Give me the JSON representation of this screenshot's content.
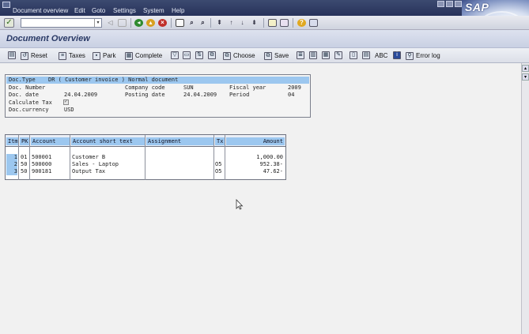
{
  "menubar": {
    "items": [
      "Document overview",
      "Edit",
      "Goto",
      "Settings",
      "System",
      "Help"
    ],
    "logo_text": "SAP"
  },
  "std_toolbar": {
    "command_value": ""
  },
  "title": "Document Overview",
  "app_toolbar": {
    "reset": "Reset",
    "taxes": "Taxes",
    "park": "Park",
    "complete": "Complete",
    "choose": "Choose",
    "save": "Save",
    "abc": "ABC",
    "error_log": "Error log"
  },
  "header": {
    "doc_type_label": "Doc.Type",
    "doc_type_value": "DR ( Customer invoice ) Normal document",
    "doc_number_label": "Doc. Number",
    "company_code_label": "Company code",
    "company_code_value": "SUN",
    "fiscal_year_label": "Fiscal year",
    "fiscal_year_value": "2009",
    "doc_date_label": "Doc. date",
    "doc_date_value": "24.04.2009",
    "posting_date_label": "Posting date",
    "posting_date_value": "24.04.2009",
    "period_label": "Period",
    "period_value": "04",
    "calculate_tax_label": "Calculate Tax",
    "calculate_tax_checked": true,
    "doc_currency_label": "Doc.currency",
    "doc_currency_value": "USD"
  },
  "table": {
    "columns": [
      "Itm",
      "PK",
      "Account",
      "Account short text",
      "Assignment",
      "Tx",
      "Amount"
    ],
    "rows": [
      {
        "itm": "1",
        "pk": "01",
        "account": "500001",
        "text": "Customer B",
        "assignment": "",
        "tx": "",
        "amount": "1,000.00"
      },
      {
        "itm": "2",
        "pk": "50",
        "account": "500000",
        "text": "Sales - Laptop",
        "assignment": "",
        "tx": "O5",
        "amount": "952.38-"
      },
      {
        "itm": "3",
        "pk": "50",
        "account": "900181",
        "text": "Output Tax",
        "assignment": "",
        "tx": "O5",
        "amount": "47.62-"
      }
    ]
  }
}
